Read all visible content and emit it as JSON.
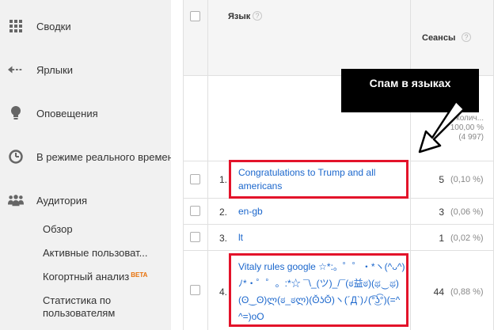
{
  "sidebar": {
    "items": [
      {
        "label": "Сводки",
        "icon": "grid-icon"
      },
      {
        "label": "Ярлыки",
        "icon": "shortcut-arrow-icon"
      },
      {
        "label": "Оповещения",
        "icon": "lightbulb-icon"
      },
      {
        "label": "В режиме реального времени",
        "icon": "clock-icon"
      },
      {
        "label": "Аудитория",
        "icon": "people-icon"
      }
    ],
    "audience_sub": [
      {
        "label": "Обзор"
      },
      {
        "label": "Активные пользоват..."
      },
      {
        "label": "Когортный анализ",
        "badge": "BETA"
      },
      {
        "label": "Статистика по пользователям"
      }
    ]
  },
  "table": {
    "col_language": "Язык",
    "col_sessions": "Сеансы",
    "total_line1": "колич...",
    "total_line2": "100,00 %",
    "total_line3": "(4 997)",
    "rows": [
      {
        "num": "1.",
        "language": "Congratulations to Trump and all americans",
        "value": "5",
        "percent": "(0,10 %)"
      },
      {
        "num": "2.",
        "language": "en-gb",
        "value": "3",
        "percent": "(0,06 %)"
      },
      {
        "num": "3.",
        "language": "lt",
        "value": "1",
        "percent": "(0,02 %)"
      },
      {
        "num": "4.",
        "language": "Vitaly rules google ☆*:。゜゜・*ヽ(^ᴗ^)ﾉ*・゜゜。:*☆ ¯\\_(ツ)_/¯(ಠ益ಠ)(ಥ‿ಥ)(ʘ‿ʘ)ლ(ಠ_ಠლ)(ʘ̆ʖʘ̆)ヽ(´Д`)ﾉ(͡°͜ʖ͡°)(=^ ^=)oO",
        "value": "44",
        "percent": "(0,88 %)"
      }
    ]
  },
  "annotation": {
    "text": "Спам в языках"
  },
  "colors": {
    "link": "#1a66cc",
    "highlight_border": "#e3132a",
    "sidebar_bg": "#f1f1f1"
  }
}
